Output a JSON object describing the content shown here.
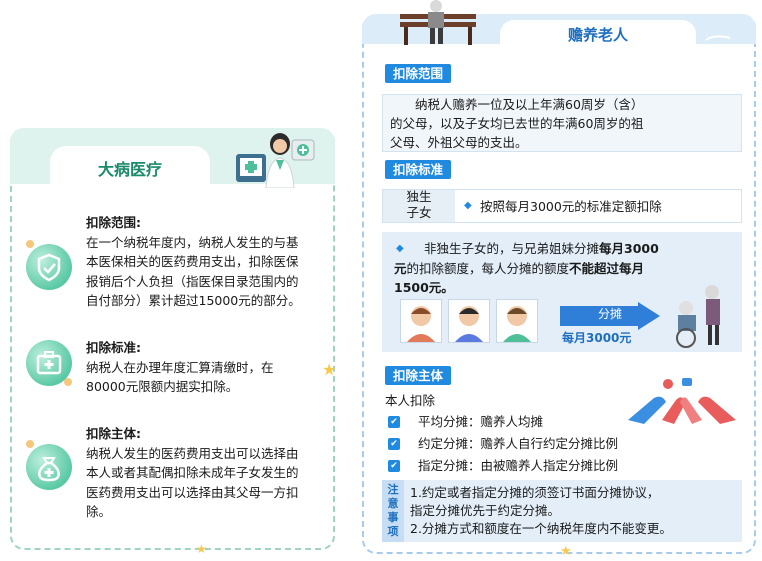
{
  "left": {
    "title": "大病医疗",
    "sections": [
      {
        "heading": "扣除范围:",
        "lines": [
          "在一个纳税年度内，纳税人发生的与基",
          "本医保相关的医药费用支出，扣除医保",
          "报销后个人负担（指医保目录范围内的",
          "自付部分）累计超过15000元的部分。"
        ]
      },
      {
        "heading": "扣除标准:",
        "lines": [
          "纳税人在办理年度汇算清缴时，在",
          "80000元限额内据实扣除。"
        ]
      },
      {
        "heading": "扣除主体:",
        "lines": [
          "纳税人发生的医药费用支出可以选择由",
          "本人或者其配偶扣除未成年子女发生的",
          "医药费用支出可以选择由其父母一方扣",
          "除。"
        ]
      }
    ]
  },
  "right": {
    "title": "赡养老人",
    "scope_label": "扣除范围",
    "scope_lines": [
      "纳税人赡养一位及以上年满60周岁（含）",
      "的父母，以及子女均已去世的年满60周岁的祖",
      "父母、外祖父母的支出。"
    ],
    "standard_label": "扣除标准",
    "only_child_label_1": "独生",
    "only_child_label_2": "子女",
    "only_child_text": "按照每月3000元的标准定额扣除",
    "non_only_line1_a": "非独生子女的，与兄弟姐妹分摊",
    "non_only_line1_b": "每月3000",
    "non_only_line2_a": "元",
    "non_only_line2_b": "的扣除额度，每人分摊的额度",
    "non_only_line2_c": "不能超过每月",
    "non_only_line3": "1500元。",
    "share_label": "分摊",
    "share_amount": "每月3000元",
    "subject_label": "扣除主体",
    "subject_intro": "本人扣除",
    "subject_items": [
      "平均分摊：赡养人均摊",
      "约定分摊：赡养人自行约定分摊比例",
      "指定分摊：由被赡养人指定分摊比例"
    ],
    "note_label": [
      "注",
      "意",
      "事",
      "项"
    ],
    "note_lines": [
      "1.约定或者指定分摊的须签订书面分摊协议，",
      "指定分摊优先于约定分摊。",
      "2.分摊方式和额度在一个纳税年度内不能变更。"
    ]
  },
  "colors": {
    "green": "#1b8a6b",
    "blue": "#1f8ae0"
  }
}
